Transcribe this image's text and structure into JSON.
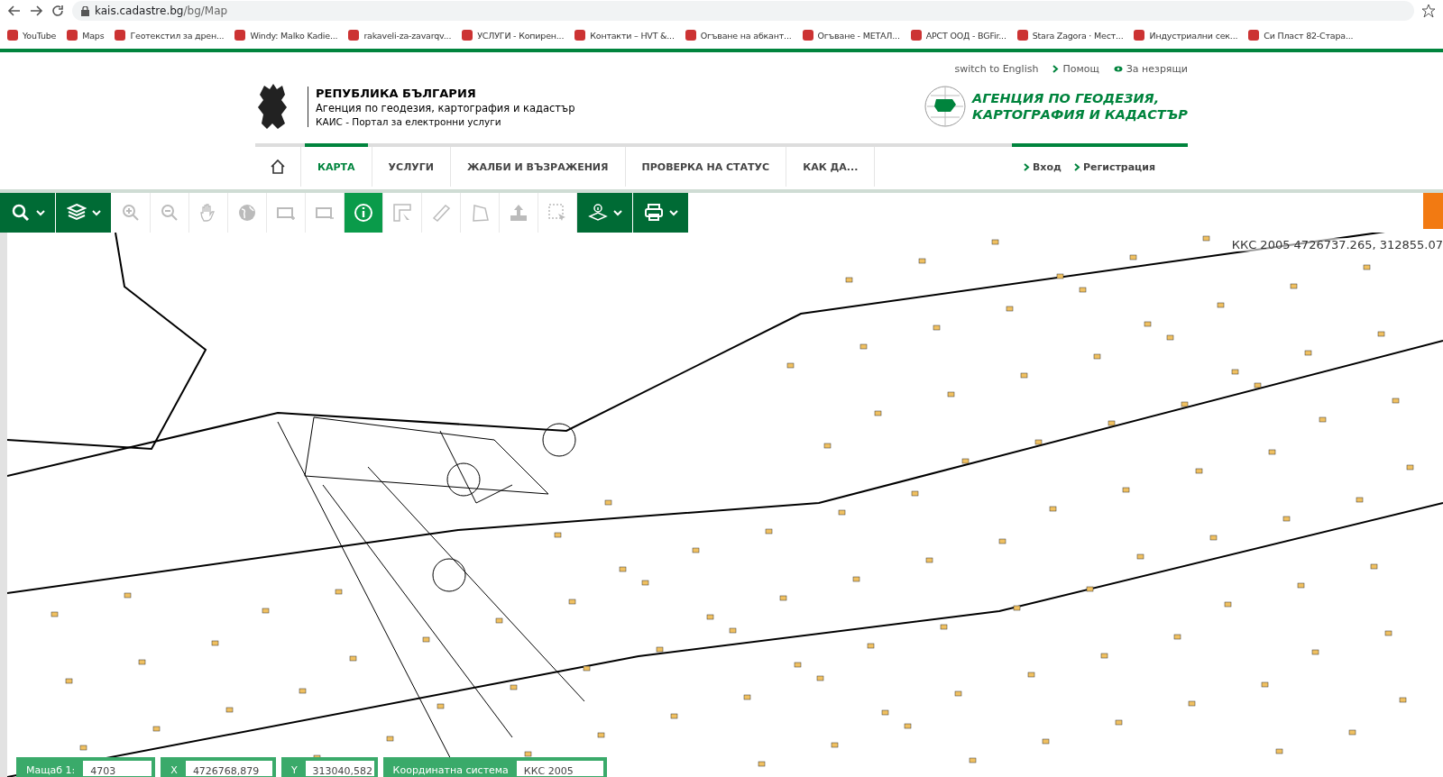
{
  "browser": {
    "url_host": "kais.cadastre.bg",
    "url_path": "/bg/Map",
    "bookmarks": [
      {
        "label": "YouTube"
      },
      {
        "label": "Maps"
      },
      {
        "label": "Геотекстил за дрен..."
      },
      {
        "label": "Windy: Malko Kadie..."
      },
      {
        "label": "rakaveli-za-zavarqv..."
      },
      {
        "label": "УСЛУГИ - Копирен..."
      },
      {
        "label": "Контакти – HVT &..."
      },
      {
        "label": "Огъване на абкант..."
      },
      {
        "label": "Огъване - МЕТАЛ..."
      },
      {
        "label": "АРСТ ООД - BGFir..."
      },
      {
        "label": "Stara Zagora · Мест..."
      },
      {
        "label": "Индустриални сек..."
      },
      {
        "label": "Си Пласт 82-Стара..."
      }
    ]
  },
  "header": {
    "top_links": [
      {
        "label": "switch to English",
        "kind": "plain"
      },
      {
        "label": "Помощ",
        "kind": "chevron"
      },
      {
        "label": "За незрящи",
        "kind": "eye"
      }
    ],
    "brand": {
      "title": "РЕПУБЛИКА БЪЛГАРИЯ",
      "subtitle": "Агенция по геодезия, картография и кадастър",
      "portal": "КАИС - Портал за електронни услуги"
    },
    "agency": [
      "АГЕНЦИЯ ПО ГЕОДЕЗИЯ,",
      "КАРТОГРАФИЯ И КАДАСТЪР"
    ],
    "nav": [
      {
        "label": "КАРТА",
        "selected": true
      },
      {
        "label": "УСЛУГИ",
        "selected": false
      },
      {
        "label": "ЖАЛБИ И ВЪЗРАЖЕНИЯ",
        "selected": false
      },
      {
        "label": "ПРОВЕРКА НА СТАТУС",
        "selected": false
      },
      {
        "label": "КАК ДА...",
        "selected": false
      }
    ],
    "auth": [
      {
        "label": "Вход"
      },
      {
        "label": "Регистрация"
      }
    ]
  },
  "toolbar": [
    {
      "kind": "dropdown",
      "selected": false
    },
    {
      "kind": "dropdown",
      "selected": false
    },
    {
      "kind": "button",
      "selected": false
    },
    {
      "kind": "button",
      "selected": false
    },
    {
      "kind": "button",
      "selected": false
    },
    {
      "kind": "button",
      "selected": false
    },
    {
      "kind": "button",
      "selected": false
    },
    {
      "kind": "button",
      "selected": false
    },
    {
      "kind": "button",
      "selected": true
    },
    {
      "kind": "button",
      "selected": false
    },
    {
      "kind": "button",
      "selected": false
    },
    {
      "kind": "button",
      "selected": false
    },
    {
      "kind": "button",
      "selected": false
    },
    {
      "kind": "button",
      "selected": false
    },
    {
      "kind": "dropdown",
      "selected": false
    },
    {
      "kind": "dropdown",
      "selected": false
    }
  ],
  "map": {
    "coordinates": "ККС 2005 4726737.265, 312855.07"
  },
  "status_bar": {
    "scale_label": "Мащаб 1:",
    "scale_value": "4703",
    "x_label": "X",
    "x_value": "4726768,879",
    "y_label": "Y",
    "y_value": "313040,582",
    "crs_label": "Координатна система",
    "crs_value": "ККС 2005"
  }
}
